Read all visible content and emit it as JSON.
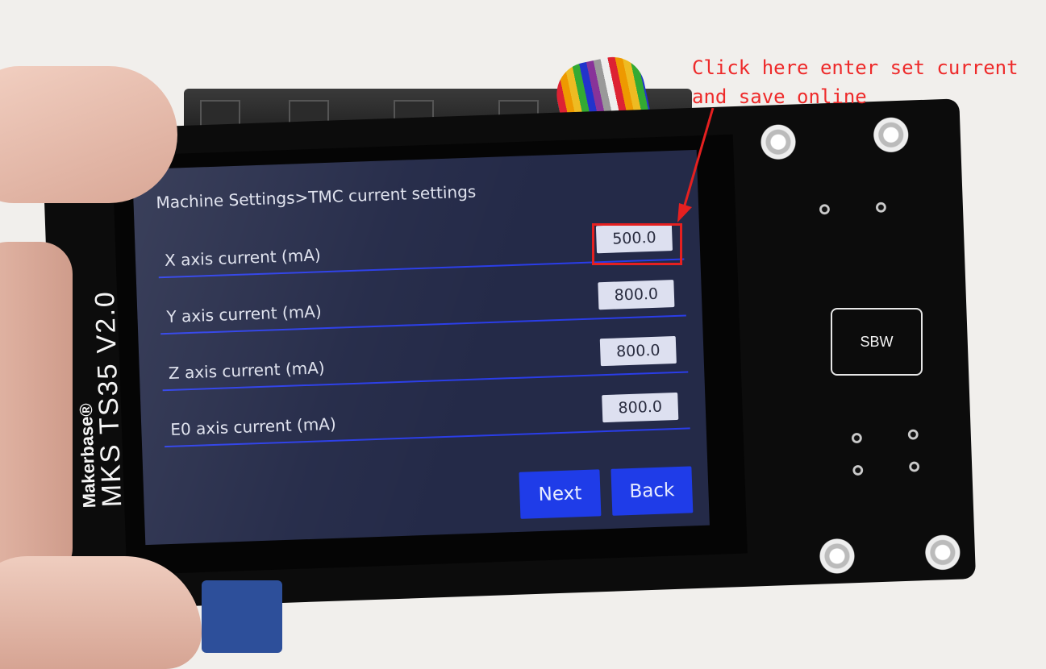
{
  "annotation": {
    "text": "Click here enter set current\nand save online",
    "color": "#ee2a2a"
  },
  "device": {
    "brand": "Makerbase®",
    "model": "MKS TS35 V2.0",
    "button_label": "SBW"
  },
  "screen": {
    "breadcrumb": "Machine Settings>TMC current settings",
    "rows": [
      {
        "label": "X axis current (mA)",
        "value": "500.0"
      },
      {
        "label": "Y axis current (mA)",
        "value": "800.0"
      },
      {
        "label": "Z axis current (mA)",
        "value": "800.0"
      },
      {
        "label": "E0 axis current (mA)",
        "value": "800.0"
      }
    ],
    "buttons": {
      "next": "Next",
      "back": "Back"
    },
    "colors": {
      "background": "#242a48",
      "accent": "#1f3ce8",
      "divider": "#2a3de8",
      "value_box": "#dde0f0"
    }
  }
}
